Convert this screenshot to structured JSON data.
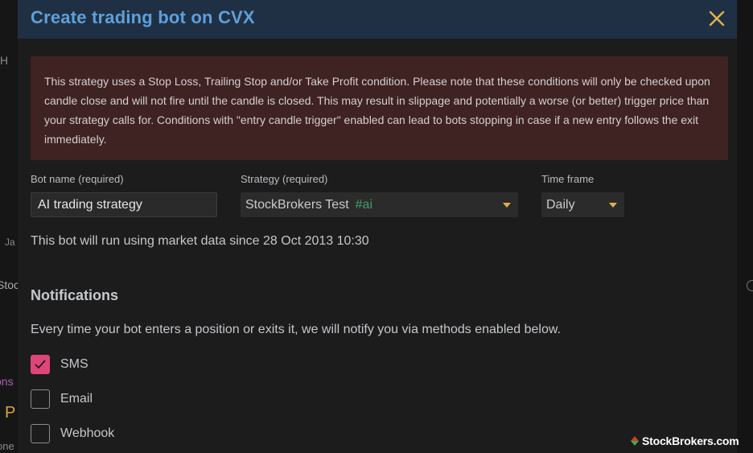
{
  "background": {
    "fragments": [
      "H",
      "Ja",
      "Stoc",
      "ons",
      "l P",
      "one"
    ]
  },
  "modal": {
    "title": "Create trading bot on CVX",
    "close_icon": "close-icon"
  },
  "warning": {
    "text": "This strategy uses a Stop Loss, Trailing Stop and/or Take Profit condition. Please note that these conditions will only be checked upon candle close and will not fire until the candle is closed. This may result in slippage and potentially a worse (or better) trigger price than your strategy calls for. Conditions with \"entry candle trigger\" enabled can lead to bots stopping in case if a new entry follows the exit immediately."
  },
  "form": {
    "bot_name_label": "Bot name (required)",
    "bot_name_value": "AI trading strategy",
    "strategy_label": "Strategy (required)",
    "strategy_value": "StockBrokers Test",
    "strategy_tag": "#ai",
    "timeframe_label": "Time frame",
    "timeframe_value": "Daily"
  },
  "info_text": "This bot will run using market data since 28 Oct 2013 10:30",
  "notifications": {
    "title": "Notifications",
    "description": "Every time your bot enters a position or exits it, we will notify you via methods enabled below.",
    "options": [
      {
        "label": "SMS",
        "checked": true
      },
      {
        "label": "Email",
        "checked": false
      },
      {
        "label": "Webhook",
        "checked": false
      }
    ]
  },
  "watermark": "StockBrokers.com",
  "colors": {
    "title": "#5da0dc",
    "accent_check": "#e0457a",
    "warning_bg": "#3f2222",
    "tag": "#3ea06a",
    "caret": "#e0b24a"
  }
}
